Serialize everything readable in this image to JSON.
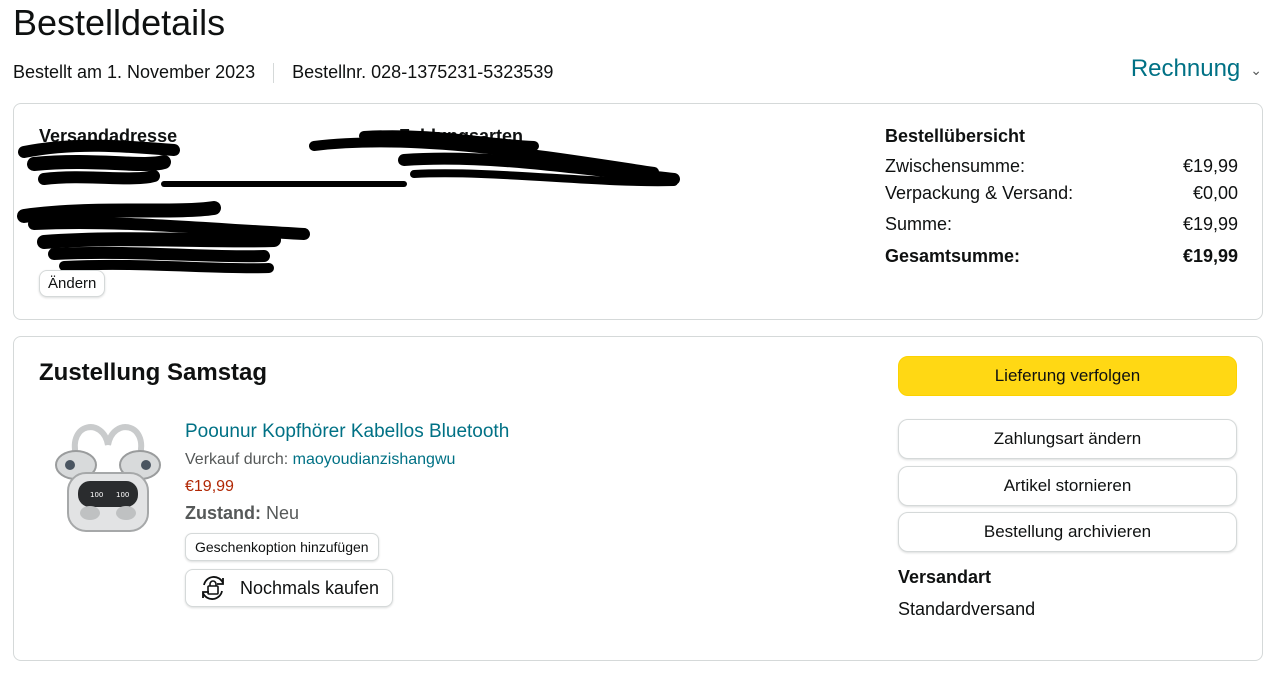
{
  "page": {
    "title": "Bestelldetails",
    "ordered_on": "Bestellt am 1. November 2023",
    "order_number": "Bestellnr. 028-1375231-5323539",
    "invoice_label": "Rechnung"
  },
  "address": {
    "heading": "Versandadresse",
    "change_label": "Ändern"
  },
  "payment": {
    "heading": "Zahlungsarten"
  },
  "summary": {
    "heading": "Bestellübersicht",
    "rows": [
      {
        "label": "Zwischensumme:",
        "value": "€19,99"
      },
      {
        "label": "Verpackung & Versand:",
        "value": "€0,00"
      },
      {
        "label": "Summe:",
        "value": "€19,99"
      }
    ],
    "total_label": "Gesamtsumme:",
    "total_value": "€19,99"
  },
  "delivery": {
    "title": "Zustellung Samstag",
    "product_name": "Poounur Kopfhörer Kabellos Bluetooth",
    "seller_prefix": "Verkauf durch:",
    "seller_name": "maoyoudianzishangwu",
    "price": "€19,99",
    "condition_label": "Zustand:",
    "condition_value": "Neu",
    "gift_label": "Geschenkoption hinzufügen",
    "rebuy_label": "Nochmals kaufen"
  },
  "actions": {
    "track": "Lieferung verfolgen",
    "change_payment": "Zahlungsart ändern",
    "cancel": "Artikel stornieren",
    "archive": "Bestellung archivieren"
  },
  "shipping": {
    "label": "Versandart",
    "value": "Standardversand"
  },
  "colors": {
    "link": "#007185",
    "primary_button": "#ffd814",
    "price": "#b12704",
    "border": "#d5d9d9"
  }
}
